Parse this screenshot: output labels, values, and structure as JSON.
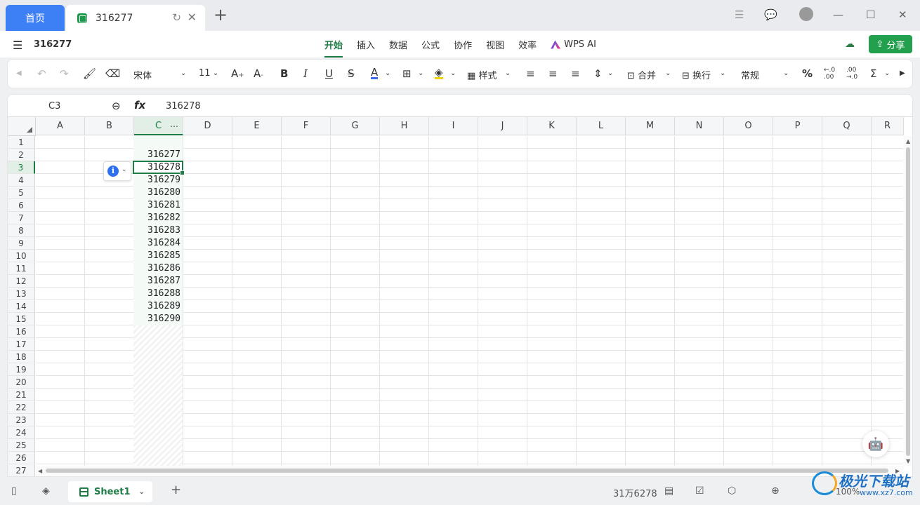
{
  "tabs": {
    "home": "首页",
    "doc_title": "316277"
  },
  "header": {
    "file_name": "316277",
    "ribbon_tabs": [
      "开始",
      "插入",
      "数据",
      "公式",
      "协作",
      "视图",
      "效率",
      "WPS AI"
    ],
    "share_label": "分享"
  },
  "toolbar": {
    "font_name": "宋体",
    "font_size": "11",
    "style_label": "样式",
    "merge_label": "合并",
    "wrap_label": "换行",
    "number_format": "常规",
    "percent": "%",
    "dec_inc": "←.0\n.00",
    "dec_dec": ".00\n→.0",
    "sum": "Σ"
  },
  "formula_bar": {
    "cell_ref": "C3",
    "fx": "fx",
    "value": "316278"
  },
  "columns": [
    "A",
    "B",
    "C",
    "D",
    "E",
    "F",
    "G",
    "H",
    "I",
    "J",
    "K",
    "L",
    "M",
    "N",
    "O",
    "P",
    "Q",
    "R"
  ],
  "rows": [
    "1",
    "2",
    "3",
    "4",
    "5",
    "6",
    "7",
    "8",
    "9",
    "10",
    "11",
    "12",
    "13",
    "14",
    "15",
    "16",
    "17",
    "18",
    "19",
    "20",
    "21",
    "22",
    "23",
    "24",
    "25",
    "26",
    "27"
  ],
  "cells_c": [
    "316277",
    "316278",
    "316279",
    "316280",
    "316281",
    "316282",
    "316283",
    "316284",
    "316285",
    "316286",
    "316287",
    "316288",
    "316289",
    "316290"
  ],
  "bottom": {
    "sheet_name": "Sheet1",
    "status_value": "31万6278",
    "zoom": "100%"
  },
  "watermark": {
    "title": "极光下载站",
    "url": "www.xz7.com"
  },
  "colors": {
    "accent": "#1e7d45",
    "brand_blue": "#3d7ff5",
    "share_green": "#22a04d"
  }
}
